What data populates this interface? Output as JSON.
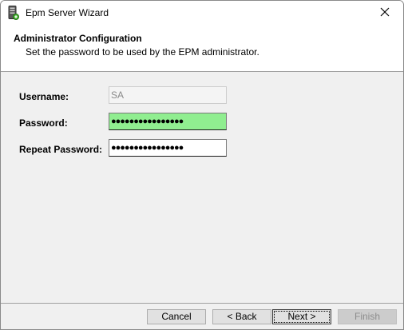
{
  "window": {
    "title": "Epm Server Wizard",
    "app_icon": "server-wizard-icon",
    "close_icon": "close-icon"
  },
  "header": {
    "title": "Administrator Configuration",
    "subtitle": "Set the password to be used by the EPM administrator."
  },
  "form": {
    "username_label": "Username:",
    "username_value": "SA",
    "password_label": "Password:",
    "password_value": "●●●●●●●●●●●●●●●●",
    "repeat_password_label": "Repeat Password:",
    "repeat_password_value": "●●●●●●●●●●●●●●●●"
  },
  "buttons": {
    "cancel": "Cancel",
    "back": "< Back",
    "next": "Next >",
    "finish": "Finish"
  },
  "colors": {
    "password_valid_bg": "#90ee90",
    "window_bg": "#f0f0f0"
  }
}
